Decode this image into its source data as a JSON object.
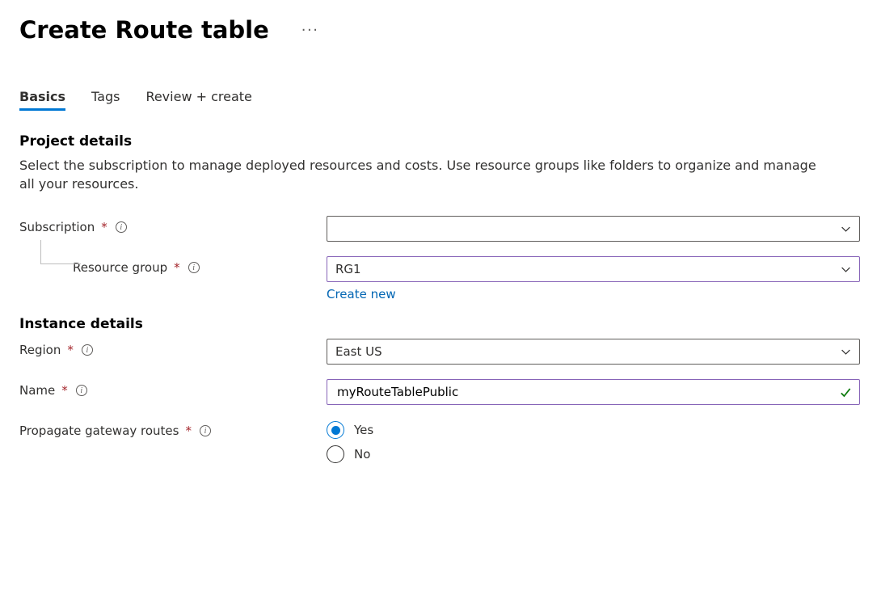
{
  "header": {
    "title": "Create Route table"
  },
  "tabs": [
    "Basics",
    "Tags",
    "Review + create"
  ],
  "sections": {
    "project": {
      "title": "Project details",
      "description": "Select the subscription to manage deployed resources and costs. Use resource groups like folders to organize and manage all your resources."
    },
    "instance": {
      "title": "Instance details"
    }
  },
  "fields": {
    "subscription": {
      "label": "Subscription",
      "value": ""
    },
    "resource_group": {
      "label": "Resource group",
      "value": "RG1",
      "create_link": "Create new"
    },
    "region": {
      "label": "Region",
      "value": "East US"
    },
    "name": {
      "label": "Name",
      "value": "myRouteTablePublic"
    },
    "propagate": {
      "label": "Propagate gateway routes",
      "options": [
        "Yes",
        "No"
      ],
      "selected": "Yes"
    }
  }
}
